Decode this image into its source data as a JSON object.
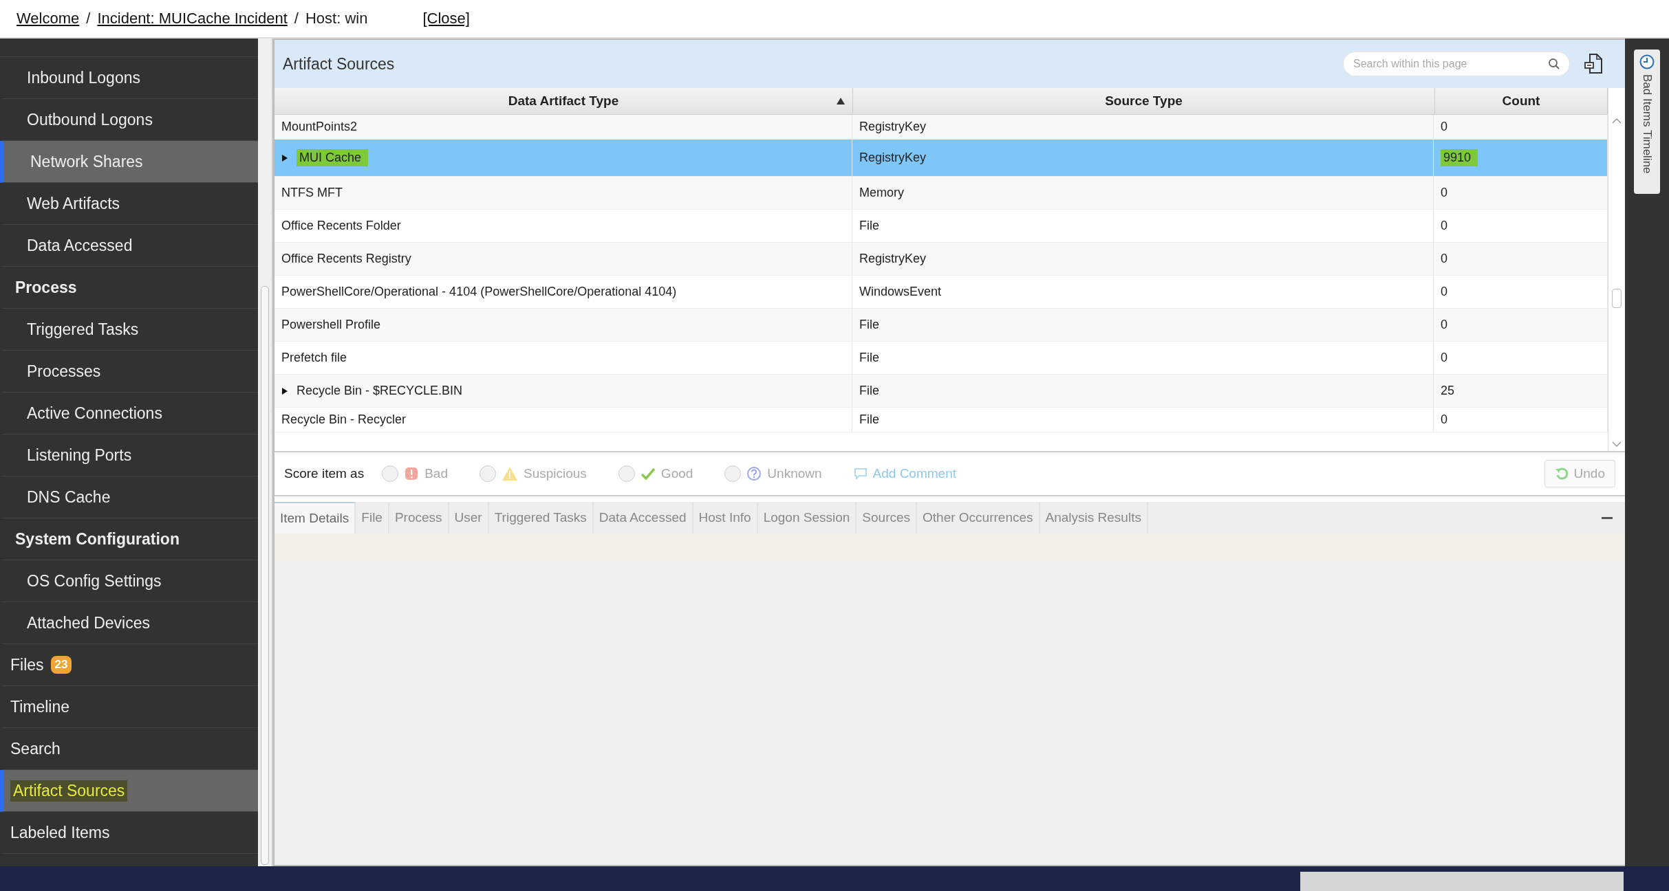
{
  "breadcrumb": {
    "links": [
      {
        "label": "Welcome",
        "separator": "/"
      },
      {
        "label": "Incident: MUICache Incident",
        "separator": "/"
      }
    ],
    "host": "Host: win",
    "close": "[Close]"
  },
  "sidebar": {
    "items": [
      {
        "label": "Inbound Logons",
        "kind": "sub",
        "selected": false,
        "hovered": false
      },
      {
        "label": "Outbound Logons",
        "kind": "sub",
        "selected": false,
        "hovered": false
      },
      {
        "label": "Network Shares",
        "kind": "sub",
        "selected": false,
        "hovered": true
      },
      {
        "label": "Web Artifacts",
        "kind": "sub",
        "selected": false,
        "hovered": false
      },
      {
        "label": "Data Accessed",
        "kind": "sub",
        "selected": false,
        "hovered": false
      },
      {
        "label": "Process",
        "kind": "group",
        "selected": false,
        "hovered": false
      },
      {
        "label": "Triggered Tasks",
        "kind": "sub",
        "selected": false,
        "hovered": false
      },
      {
        "label": "Processes",
        "kind": "sub",
        "selected": false,
        "hovered": false
      },
      {
        "label": "Active Connections",
        "kind": "sub",
        "selected": false,
        "hovered": false
      },
      {
        "label": "Listening Ports",
        "kind": "sub",
        "selected": false,
        "hovered": false
      },
      {
        "label": "DNS Cache",
        "kind": "sub",
        "selected": false,
        "hovered": false
      },
      {
        "label": "System Configuration",
        "kind": "group",
        "selected": false,
        "hovered": false
      },
      {
        "label": "OS Config Settings",
        "kind": "sub",
        "selected": false,
        "hovered": false
      },
      {
        "label": "Attached Devices",
        "kind": "sub",
        "selected": false,
        "hovered": false
      },
      {
        "label": "Files",
        "kind": "top",
        "badge": "23",
        "selected": false,
        "hovered": false
      },
      {
        "label": "Timeline",
        "kind": "top",
        "selected": false,
        "hovered": false
      },
      {
        "label": "Search",
        "kind": "top",
        "selected": false,
        "hovered": false
      },
      {
        "label": "Artifact Sources",
        "kind": "top",
        "selected": true,
        "hovered": false
      },
      {
        "label": "Labeled Items",
        "kind": "top",
        "selected": false,
        "hovered": false
      }
    ]
  },
  "panel": {
    "title": "Artifact Sources",
    "search": {
      "placeholder": "Search within this page"
    }
  },
  "table": {
    "columns": [
      {
        "label": "Data Artifact Type",
        "sorted": true
      },
      {
        "label": "Source Type",
        "sorted": false
      },
      {
        "label": "Count",
        "sorted": false
      }
    ],
    "rows": [
      {
        "name": "MountPoints2",
        "source": "RegistryKey",
        "count": "0",
        "expandable": false,
        "selected": false,
        "highlighted": false,
        "partial": true
      },
      {
        "name": "MUI Cache",
        "source": "RegistryKey",
        "count": "9910",
        "expandable": true,
        "selected": true,
        "highlighted": true,
        "partial": false
      },
      {
        "name": "NTFS MFT",
        "source": "Memory",
        "count": "0",
        "expandable": false,
        "selected": false,
        "highlighted": false,
        "partial": false
      },
      {
        "name": "Office Recents Folder",
        "source": "File",
        "count": "0",
        "expandable": false,
        "selected": false,
        "highlighted": false,
        "partial": false
      },
      {
        "name": "Office Recents Registry",
        "source": "RegistryKey",
        "count": "0",
        "expandable": false,
        "selected": false,
        "highlighted": false,
        "partial": false
      },
      {
        "name": "PowerShellCore/Operational - 4104 (PowerShellCore/Operational 4104)",
        "source": "WindowsEvent",
        "count": "0",
        "expandable": false,
        "selected": false,
        "highlighted": false,
        "partial": false
      },
      {
        "name": "Powershell Profile",
        "source": "File",
        "count": "0",
        "expandable": false,
        "selected": false,
        "highlighted": false,
        "partial": false
      },
      {
        "name": "Prefetch file",
        "source": "File",
        "count": "0",
        "expandable": false,
        "selected": false,
        "highlighted": false,
        "partial": false
      },
      {
        "name": "Recycle Bin - $RECYCLE.BIN",
        "source": "File",
        "count": "25",
        "expandable": true,
        "selected": false,
        "highlighted": false,
        "partial": false
      },
      {
        "name": "Recycle Bin - Recycler",
        "source": "File",
        "count": "0",
        "expandable": false,
        "selected": false,
        "highlighted": false,
        "partial": true
      }
    ]
  },
  "score": {
    "label": "Score item as",
    "options": [
      {
        "label": "Bad",
        "kind": "bad",
        "checked": false
      },
      {
        "label": "Suspicious",
        "kind": "suspicious",
        "checked": false
      },
      {
        "label": "Good",
        "kind": "good",
        "checked": false
      },
      {
        "label": "Unknown",
        "kind": "unknown",
        "checked": false
      }
    ],
    "comment": "Add Comment",
    "undo": {
      "label": "Undo",
      "disabled": true
    }
  },
  "detail_tabs": [
    {
      "label": "Item Details",
      "selected": true
    },
    {
      "label": "File",
      "selected": false
    },
    {
      "label": "Process",
      "selected": false
    },
    {
      "label": "User",
      "selected": false
    },
    {
      "label": "Triggered Tasks",
      "selected": false
    },
    {
      "label": "Data Accessed",
      "selected": false
    },
    {
      "label": "Host Info",
      "selected": false
    },
    {
      "label": "Logon Session",
      "selected": false
    },
    {
      "label": "Sources",
      "selected": false
    },
    {
      "label": "Other Occurrences",
      "selected": false
    },
    {
      "label": "Analysis Results",
      "selected": false
    }
  ],
  "side_tab": {
    "label": "Bad Items Timeline"
  }
}
